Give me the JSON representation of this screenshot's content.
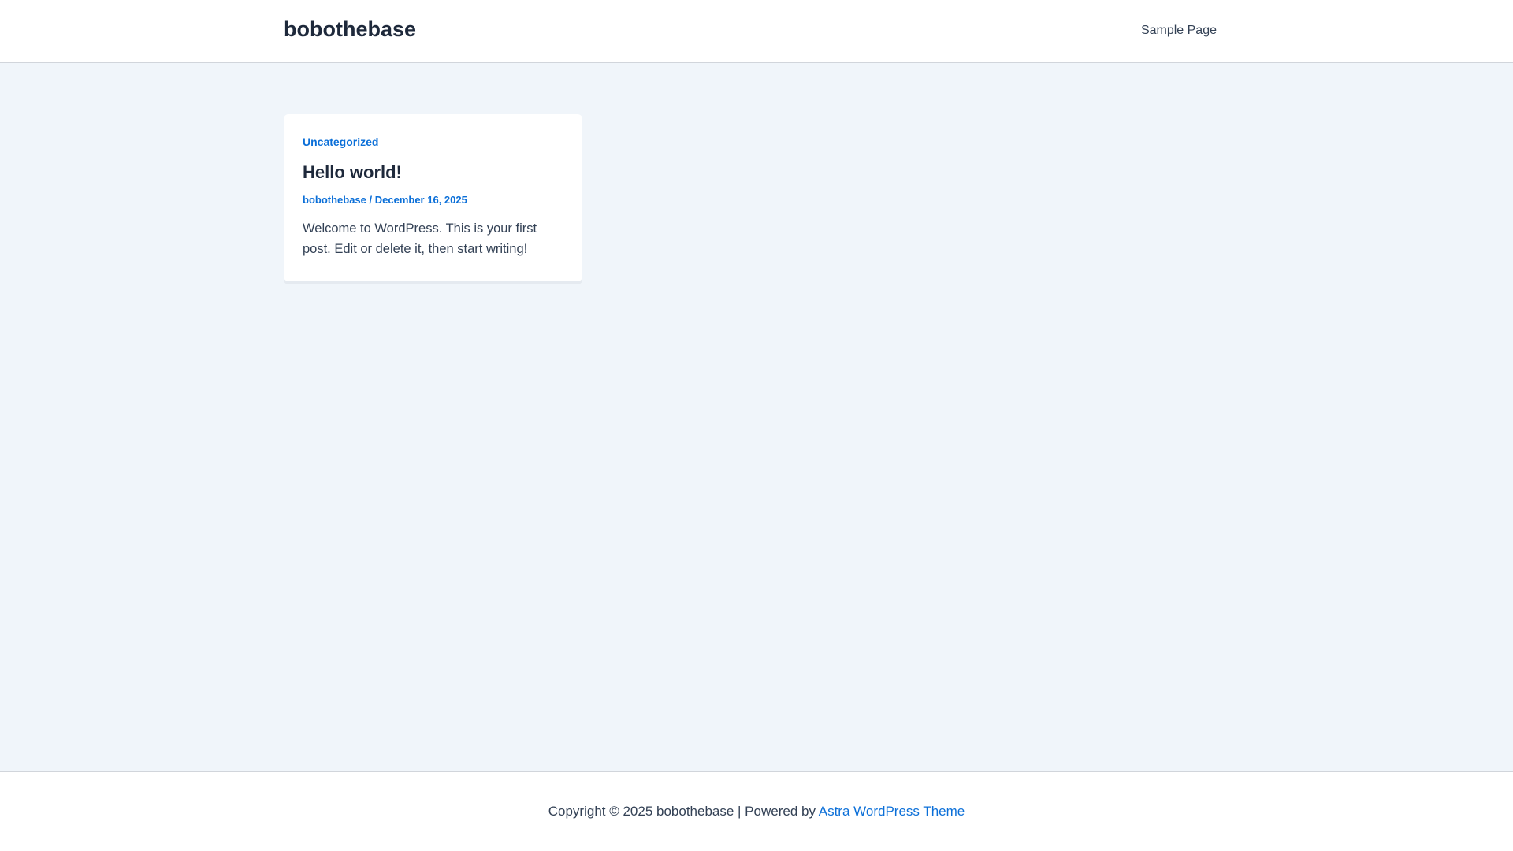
{
  "header": {
    "site_title": "bobothebase",
    "nav": [
      {
        "label": "Sample Page"
      }
    ]
  },
  "post": {
    "category": "Uncategorized",
    "title": "Hello world!",
    "author": "bobothebase",
    "separator": " / ",
    "date": "December 16, 2025",
    "excerpt": "Welcome to WordPress. This is your first post. Edit or delete it, then start writing!"
  },
  "footer": {
    "copyright": "Copyright © 2025 bobothebase | Powered by ",
    "theme_link": "Astra WordPress Theme"
  }
}
